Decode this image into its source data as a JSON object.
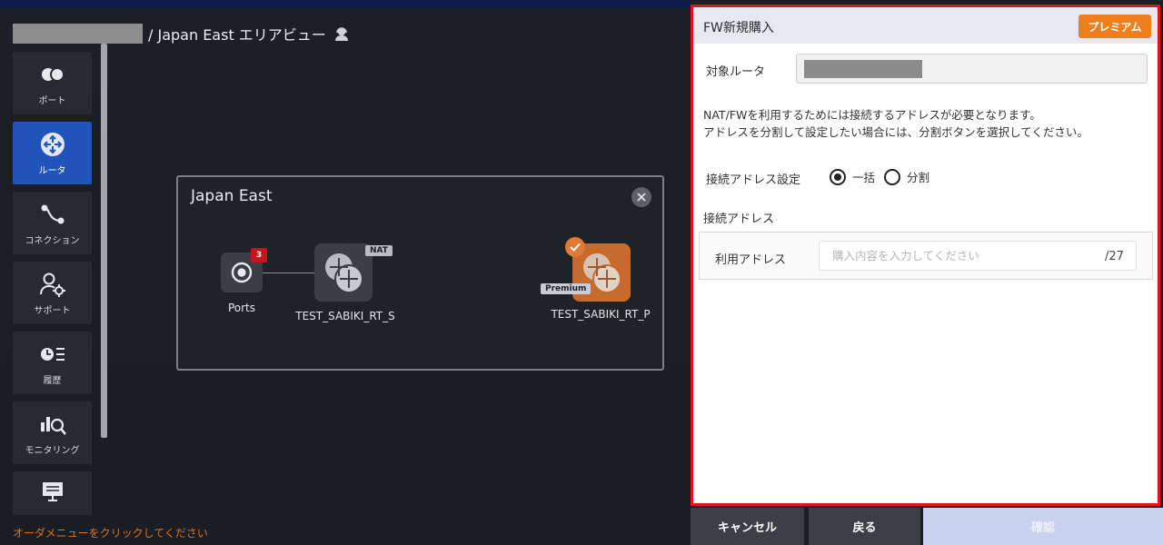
{
  "breadcrumb": {
    "text": "/ Japan East エリアビュー"
  },
  "sidebar": {
    "items": [
      {
        "label": "ポート",
        "icon": "ports-icon"
      },
      {
        "label": "ルータ",
        "icon": "router-icon"
      },
      {
        "label": "コネクション",
        "icon": "connection-icon"
      },
      {
        "label": "サポート",
        "icon": "support-icon"
      },
      {
        "label": "履歴",
        "icon": "history-icon"
      },
      {
        "label": "モニタリング",
        "icon": "monitoring-icon"
      },
      {
        "label": "",
        "icon": "order-menu-icon"
      }
    ],
    "active_index": 1
  },
  "order_hint": "オーダメニューをクリックしてください",
  "region": {
    "title": "Japan East",
    "ports": {
      "label": "Ports",
      "badge": "3"
    },
    "routers": [
      {
        "label": "TEST_SABIKI_RT_S",
        "badge": "NAT"
      },
      {
        "label": "TEST_SABIKI_RT_P",
        "badge": "Premium"
      }
    ]
  },
  "panel": {
    "title": "FW新規購入",
    "premium_label": "プレミアム",
    "router_label": "対象ルータ",
    "description_line1": "NAT/FWを利用するためには接続するアドレスが必要となります。",
    "description_line2": "アドレスを分割して設定したい場合には、分割ボタンを選択してください。",
    "address_setting_label": "接続アドレス設定",
    "options": [
      "一括",
      "分割"
    ],
    "selected_option": "一括",
    "address_section_label": "接続アドレス",
    "use_address_label": "利用アドレス",
    "address_placeholder": "購入内容を入力してください",
    "address_value": "",
    "address_suffix": "/27"
  },
  "footer": {
    "cancel": "キャンセル",
    "back": "戻る",
    "confirm": "確認"
  },
  "colors": {
    "accent": "#2154b8",
    "premium": "#f07f1b",
    "panel_border": "#e1141e",
    "hint": "#e0711c"
  }
}
